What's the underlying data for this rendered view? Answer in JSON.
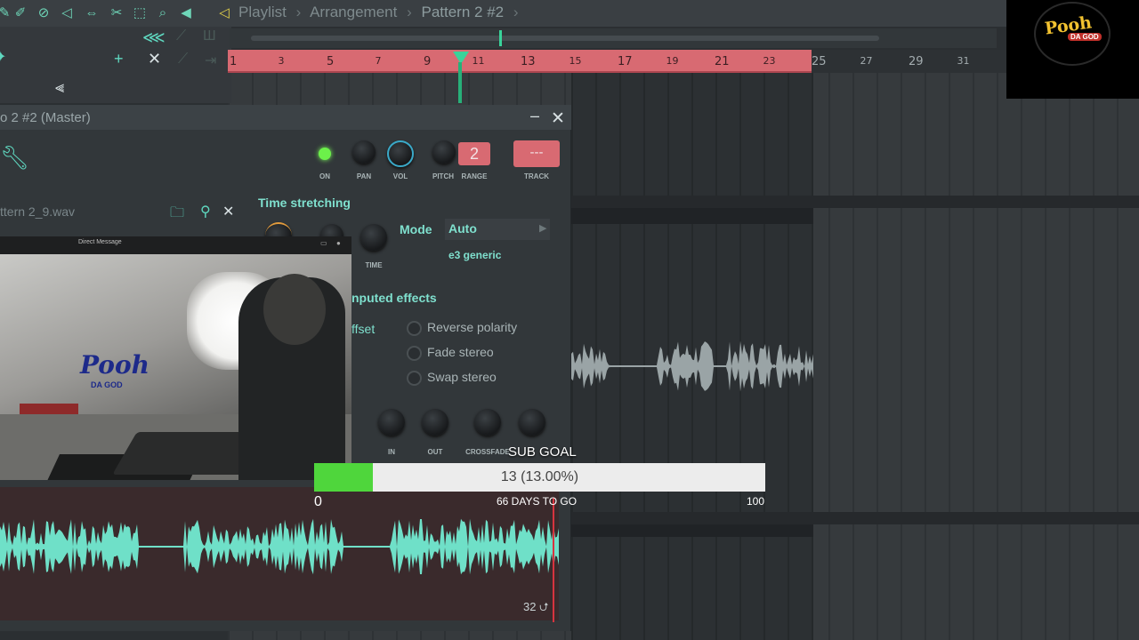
{
  "breadcrumb": {
    "items": [
      "Playlist",
      "Arrangement",
      "Pattern 2 #2"
    ],
    "separator": "›"
  },
  "icons": {
    "toolbar": [
      "magnet-icon",
      "paint-icon",
      "delete-icon",
      "mute-icon",
      "slip-icon",
      "slice-icon",
      "select-icon",
      "zoom-icon",
      "playback-icon"
    ],
    "toolbar2": [
      "waveform-icon",
      "link-icon",
      "piano-icon",
      "plus-icon",
      "cross-icon",
      "step-icon",
      "arrow-icon"
    ]
  },
  "ruler": {
    "ticks": [
      "1",
      "3",
      "5",
      "7",
      "9",
      "11",
      "13",
      "15",
      "17",
      "19",
      "21",
      "23",
      "25",
      "27",
      "29",
      "31"
    ],
    "loop_end_index": 11
  },
  "channel_window": {
    "title": "o 2 #2 (Master)",
    "minimize": "–",
    "close": "✕",
    "knobs": [
      "ON",
      "PAN",
      "VOL",
      "PITCH",
      "RANGE"
    ],
    "range_value": "2",
    "track_value": "---",
    "track_label": "TRACK",
    "filename": "ttern 2_9.wav",
    "time_stretching": "Time stretching",
    "time_label": "TIME",
    "mode_label": "Mode",
    "mode_value": "Auto",
    "mode_sub": "e3 generic",
    "precomputed": "nputed effects",
    "offset": "ffset",
    "options": [
      "Reverse polarity",
      "Fade stereo",
      "Swap stereo"
    ],
    "bottom_knobs": [
      "IN",
      "OUT",
      "CROSSFADE"
    ],
    "bar_label": "32"
  },
  "webcam": {
    "title": "Direct Message",
    "logo_text": "Pooh",
    "logo_sub": "DA GOD"
  },
  "logo": {
    "text": "Pooh",
    "sub": "DA GOD"
  },
  "sub_goal": {
    "title": "SUB GOAL",
    "value_text": "13 (13.00%)",
    "progress": 0.13,
    "min": "0",
    "max": "100",
    "days": "66 DAYS TO GO"
  },
  "colors": {
    "accent": "#5fd8c0",
    "loop": "#d86a72",
    "playhead": "#39d39a",
    "goal": "#4fd63c"
  }
}
